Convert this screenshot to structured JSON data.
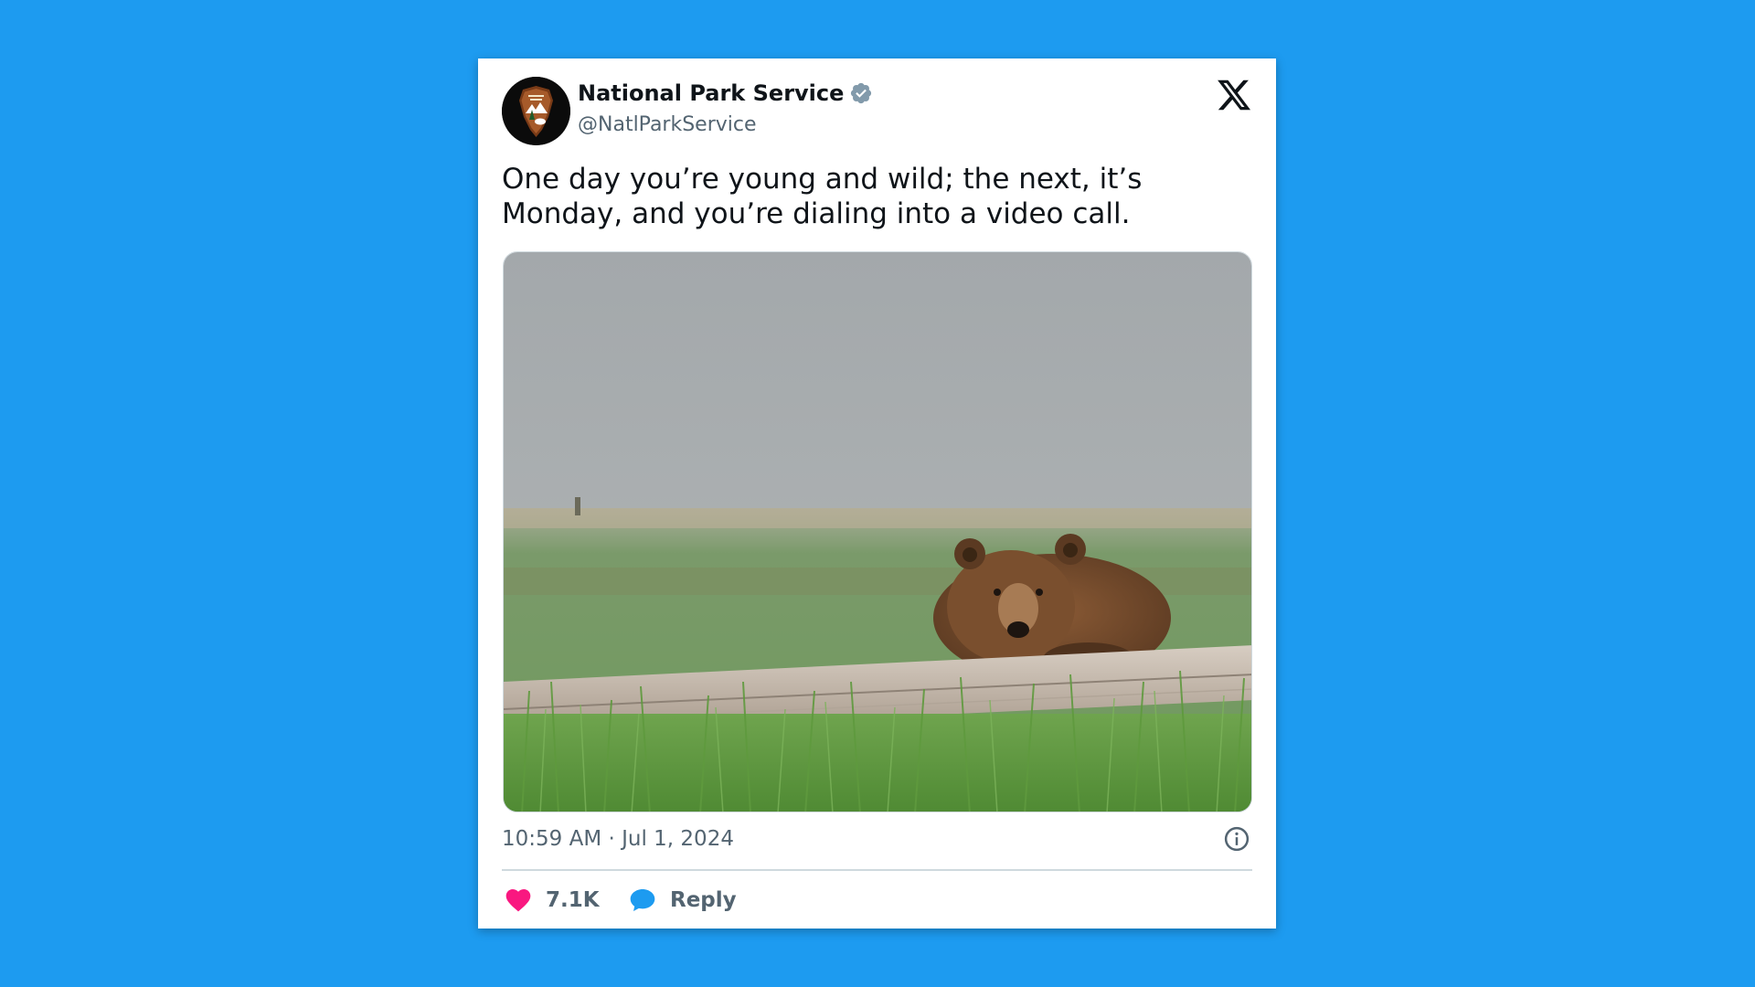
{
  "tweet": {
    "author": {
      "name": "National Park Service",
      "handle": "@NatlParkService",
      "avatar_icon": "nps-arrowhead-logo",
      "verified_icon": "verified-badge-icon"
    },
    "text": "One day you’re young and wild; the next, it’s Monday, and you’re dialing into a video call.",
    "media": {
      "description_icon": "bear-resting-on-log-photo"
    },
    "timestamp": "10:59 AM · Jul 1, 2024",
    "actions": {
      "like_count": "7.1K",
      "reply_label": "Reply"
    }
  },
  "colors": {
    "background": "#1d9bf0",
    "card": "#ffffff",
    "text_primary": "#0f1419",
    "text_secondary": "#536471",
    "like": "#f91880",
    "reply": "#1d9bf0",
    "verified": "#829aab"
  }
}
